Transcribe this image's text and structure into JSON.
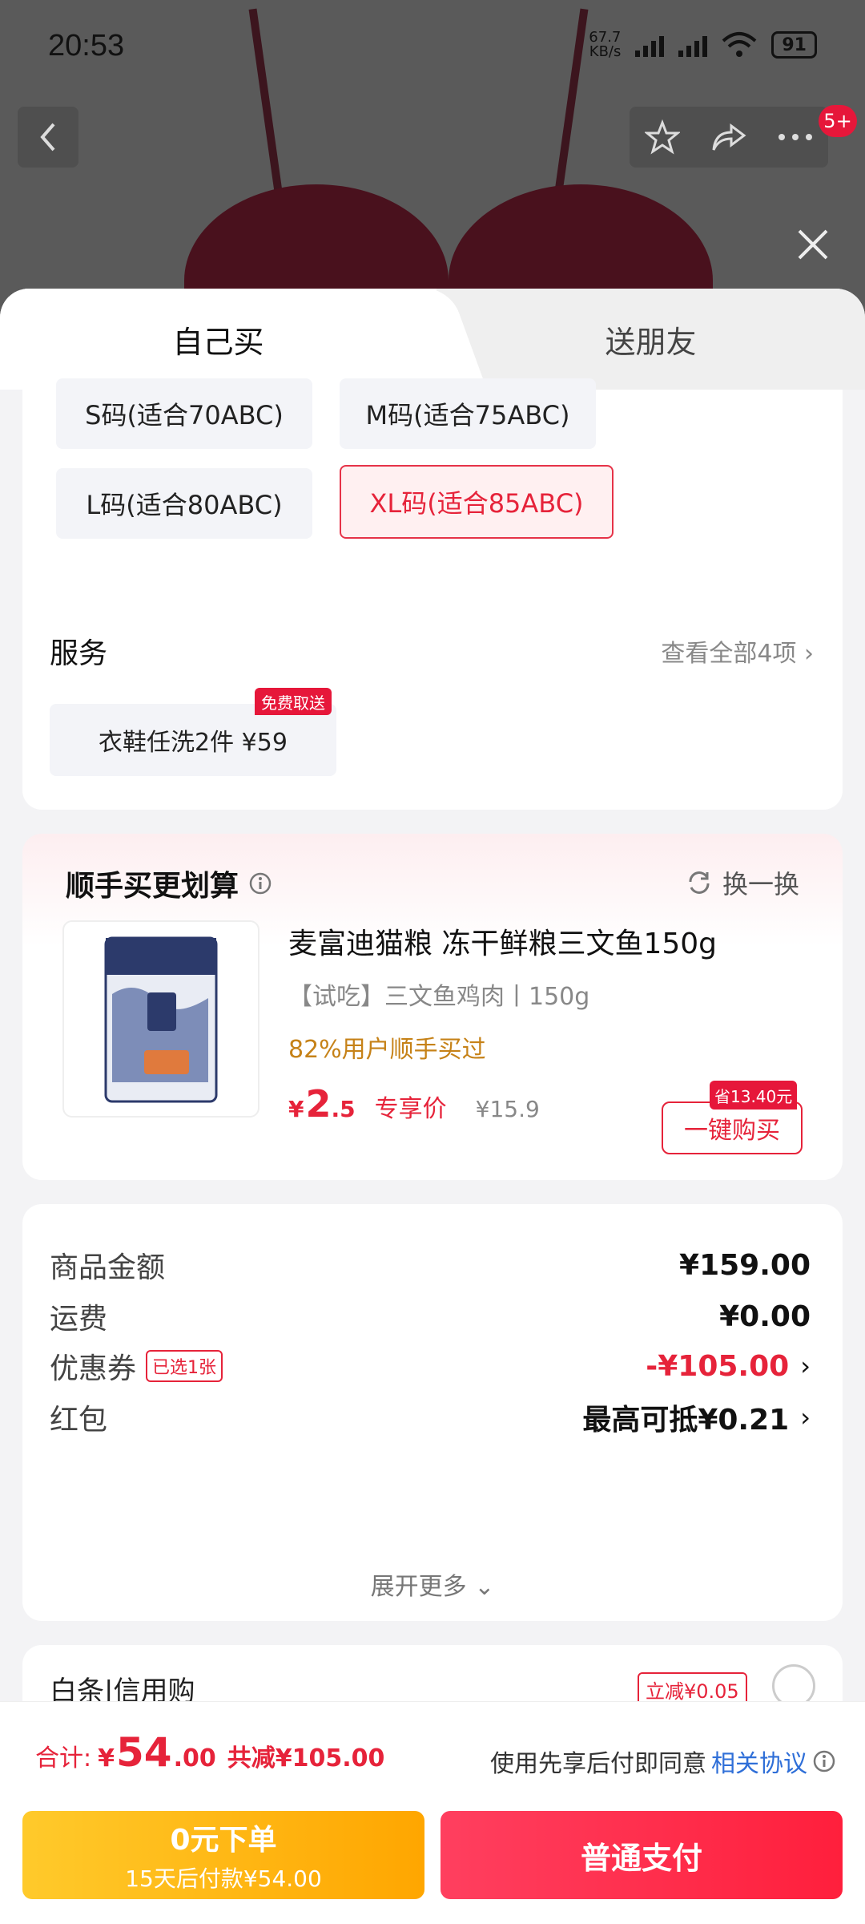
{
  "status_bar": {
    "time": "20:53",
    "net_rate_value": "67.7",
    "net_rate_unit": "KB/s",
    "battery": "91"
  },
  "header": {
    "badge": "5+"
  },
  "tabs": {
    "self": "自己买",
    "friend": "送朋友"
  },
  "sizes": [
    {
      "label": "S码(适合70ABC)",
      "selected": false
    },
    {
      "label": "M码(适合75ABC)",
      "selected": false
    },
    {
      "label": "L码(适合80ABC)",
      "selected": false
    },
    {
      "label": "XL码(适合85ABC)",
      "selected": true
    }
  ],
  "service": {
    "title": "服务",
    "view_all": "查看全部4项",
    "chip_label": "衣鞋任洗2件 ¥59",
    "chip_tag": "免费取送"
  },
  "addon": {
    "title": "顺手买更划算",
    "swap": "换一换",
    "product_name": "麦富迪猫粮 冻干鲜粮三文鱼150g",
    "product_spec": "【试吃】三文鱼鸡肉丨150g",
    "bought_text": "82%用户顺手买过",
    "price_yen": "¥",
    "price_int": "2",
    "price_dec": ".5",
    "price_label": "专享价",
    "orig_price": "¥15.9",
    "save_tag": "省13.40元",
    "buy_button": "一键购买"
  },
  "summary": {
    "rows": [
      {
        "label": "商品金额",
        "value": "¥159.00"
      },
      {
        "label": "运费",
        "value": "¥0.00"
      },
      {
        "label": "优惠券",
        "tag": "已选1张",
        "value": "-¥105.00"
      },
      {
        "label": "红包",
        "value": "最高可抵¥0.21"
      }
    ],
    "more": "展开更多"
  },
  "credit": {
    "title": "白条|信用购",
    "tag": "立减¥0.05"
  },
  "bottom": {
    "total_label": "合计:",
    "total_yen": "¥",
    "total_int": "54",
    "total_dec": ".00",
    "total_off": "共减¥105.00",
    "agree_text": "使用先享后付即同意",
    "agree_link": "相关协议",
    "btn_zero_l1": "0元下单",
    "btn_zero_l2": "15天后付款¥54.00",
    "btn_pay": "普通支付"
  },
  "colors": {
    "accent": "#e6233a",
    "gold": "#ffa600",
    "link": "#2f6fd8"
  }
}
